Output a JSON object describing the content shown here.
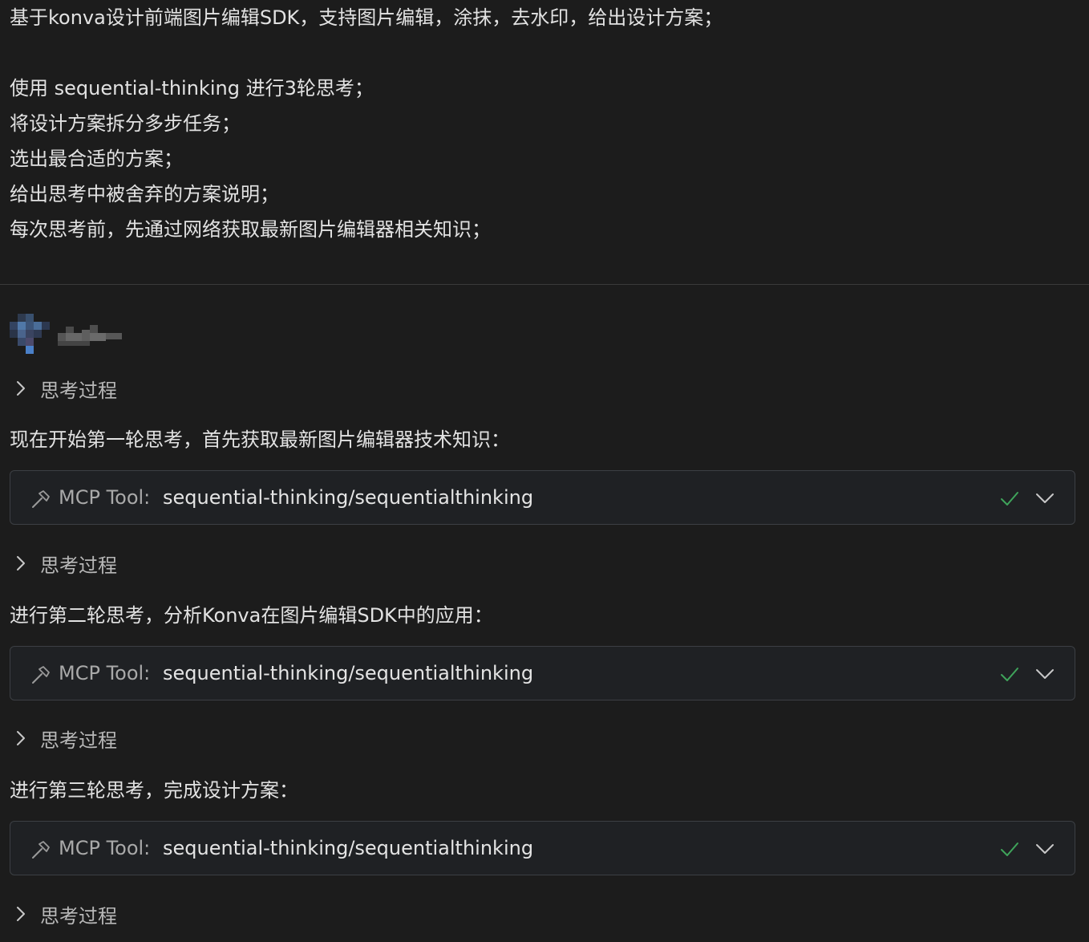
{
  "user_message": {
    "lines": [
      "基于konva设计前端图片编辑SDK，支持图片编辑，涂抹，去水印，给出设计方案；",
      "",
      "使用 sequential-thinking 进行3轮思考；",
      "将设计方案拆分多步任务；",
      "选出最合适的方案；",
      "给出思考中被舍弃的方案说明；",
      "每次思考前，先通过网络获取最新图片编辑器相关知识；"
    ]
  },
  "assistant": {
    "thinking_label": "思考过程",
    "rounds": [
      {
        "intro": "现在开始第一轮思考，首先获取最新图片编辑器技术知识：",
        "tool_prefix": "MCP Tool:",
        "tool_name": "sequential-thinking/sequentialthinking"
      },
      {
        "intro": "进行第二轮思考，分析Konva在图片编辑SDK中的应用：",
        "tool_prefix": "MCP Tool:",
        "tool_name": "sequential-thinking/sequentialthinking"
      },
      {
        "intro": "进行第三轮思考，完成设计方案：",
        "tool_prefix": "MCP Tool:",
        "tool_name": "sequential-thinking/sequentialthinking"
      }
    ]
  },
  "icons": {
    "thinking_toggle": "chevron-right-icon",
    "tool": "hammer-icon",
    "status": "check-icon",
    "expand": "chevron-down-icon"
  },
  "colors": {
    "background": "#1c1c1c",
    "text": "#e2e2e2",
    "muted_text": "#b8b8b8",
    "card_border": "#3c3f44",
    "success": "#3fa45b"
  }
}
